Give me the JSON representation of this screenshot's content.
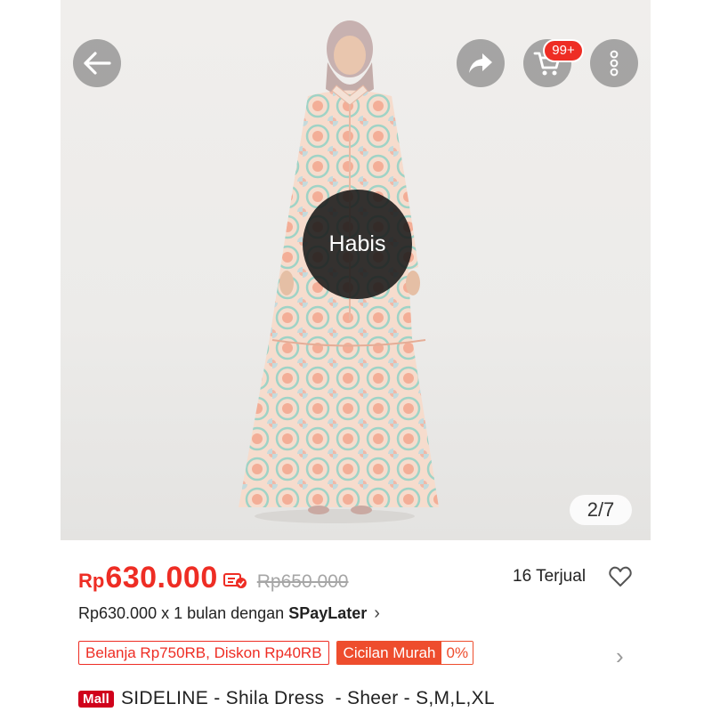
{
  "gallery": {
    "soldout_label": "Habis",
    "page_counter": "2/7"
  },
  "header": {
    "back_icon": "arrow-left-icon",
    "share_icon": "share-icon",
    "cart_icon": "cart-icon",
    "cart_badge": "99+",
    "more_icon": "more-vertical-icon"
  },
  "price": {
    "currency": "Rp",
    "current": "630.000",
    "coin_icon": "coin-voucher-icon",
    "original": "Rp650.000",
    "sold": "16 Terjual"
  },
  "paylater": {
    "text": "Rp630.000 x 1 bulan dengan",
    "brand": "SPayLater",
    "chevron": "›"
  },
  "promos": {
    "discount": "Belanja Rp750RB, Diskon Rp40RB",
    "installment_label": "Cicilan Murah",
    "installment_rate": "0%",
    "chevron": "›"
  },
  "product": {
    "mall_badge": "Mall",
    "title": "SIDELINE - Shila Dress  - Sheer - S,M,L,XL"
  },
  "colors": {
    "accent": "#ee2d24",
    "mall": "#d0011b"
  }
}
